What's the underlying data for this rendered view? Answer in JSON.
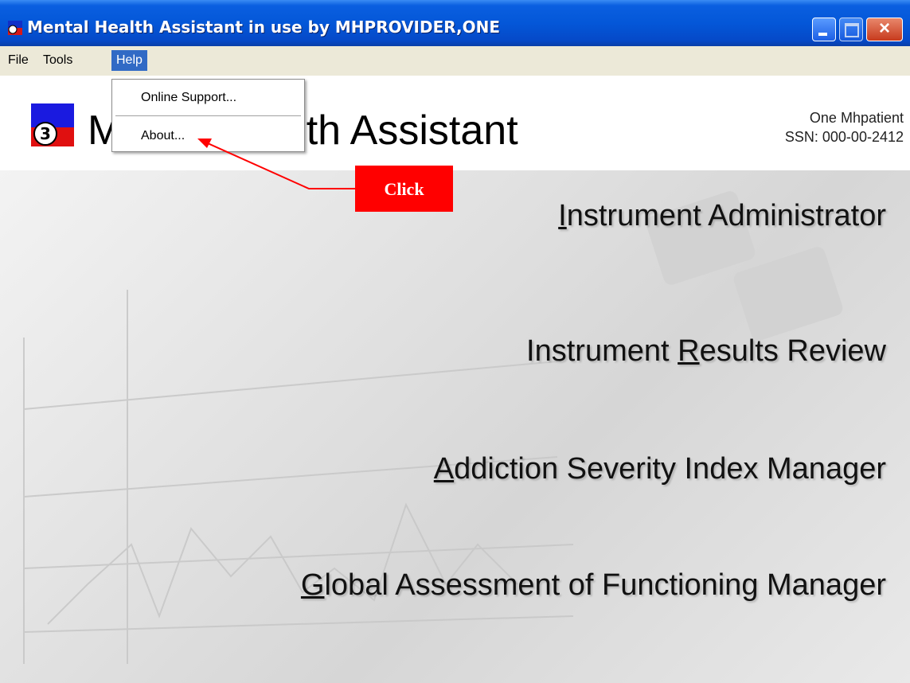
{
  "window": {
    "title": "Mental Health Assistant in use by MHPROVIDER,ONE",
    "close_glyph": "×",
    "icon": "app-logo-icon"
  },
  "menubar": {
    "items": [
      {
        "label": "File"
      },
      {
        "label": "Tools"
      },
      {
        "label": "Help"
      }
    ],
    "active": "Help"
  },
  "help_menu": {
    "items": [
      {
        "label": "Online Support..."
      },
      {
        "label": "About..."
      }
    ]
  },
  "header": {
    "app_title_left": "M",
    "app_title_right": "ealth Assistant",
    "patient_name": "One Mhpatient",
    "patient_ssn": "SSN: 000-00-2412"
  },
  "nav": {
    "instrument_administrator": {
      "first": "I",
      "rest": "nstrument Administrator"
    },
    "instrument_results_review": {
      "pre": "Instrument ",
      "mnemonic": "R",
      "post": "esults Review"
    },
    "addiction_severity": {
      "first": "A",
      "rest": "ddiction Severity Index Manager"
    },
    "global_assessment": {
      "first": "G",
      "rest": "lobal Assessment of Functioning Manager"
    }
  },
  "annotation": {
    "label": "Click"
  },
  "colors": {
    "titlebar": "#0457d8",
    "menu_highlight": "#316ac5",
    "callout": "#ff0000",
    "menubar_bg": "#ece9d8"
  }
}
